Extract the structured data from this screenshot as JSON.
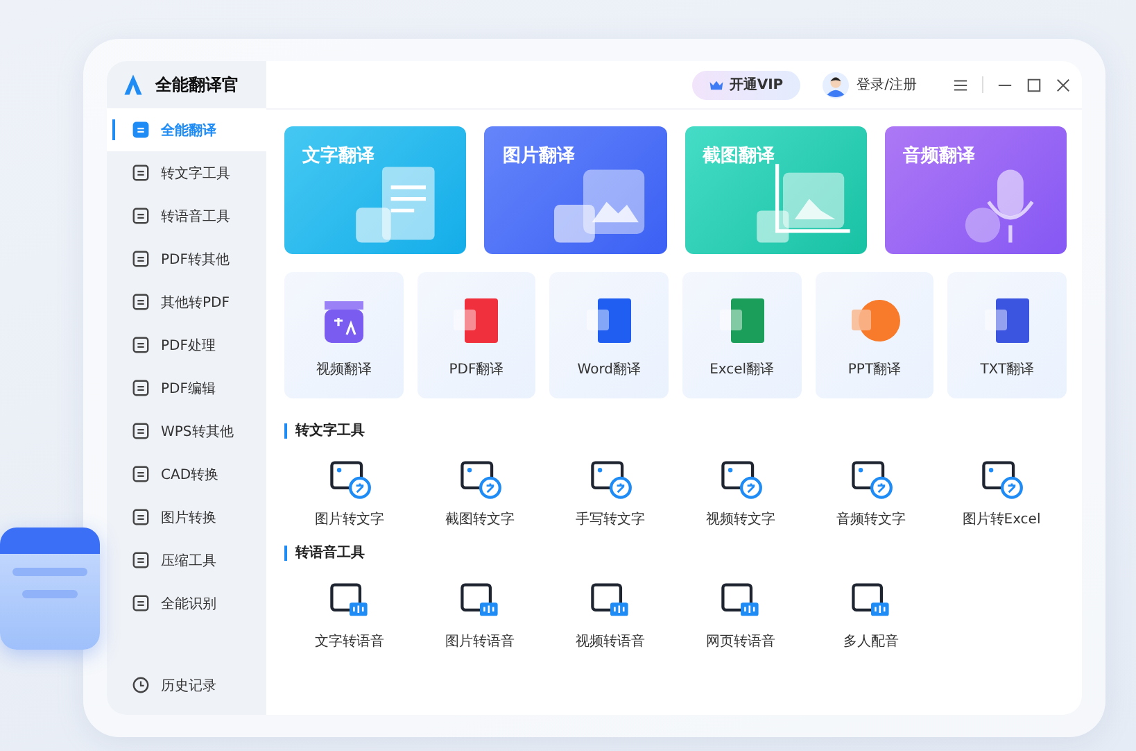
{
  "app": {
    "title": "全能翻译官"
  },
  "header": {
    "vip_button": "开通VIP",
    "login": "登录/注册"
  },
  "sidebar": {
    "items": [
      {
        "label": "全能翻译",
        "selected": true
      },
      {
        "label": "转文字工具",
        "selected": false
      },
      {
        "label": "转语音工具",
        "selected": false
      },
      {
        "label": "PDF转其他",
        "selected": false
      },
      {
        "label": "其他转PDF",
        "selected": false
      },
      {
        "label": "PDF处理",
        "selected": false
      },
      {
        "label": "PDF编辑",
        "selected": false
      },
      {
        "label": "WPS转其他",
        "selected": false
      },
      {
        "label": "CAD转换",
        "selected": false
      },
      {
        "label": "图片转换",
        "selected": false
      },
      {
        "label": "压缩工具",
        "selected": false
      },
      {
        "label": "全能识别",
        "selected": false
      }
    ],
    "footer_item": {
      "label": "历史记录"
    }
  },
  "feature_cards": [
    {
      "label": "文字翻译",
      "kind": "text"
    },
    {
      "label": "图片翻译",
      "kind": "image"
    },
    {
      "label": "截图翻译",
      "kind": "screenshot"
    },
    {
      "label": "音频翻译",
      "kind": "audio"
    }
  ],
  "file_tiles": [
    {
      "label": "视频翻译",
      "kind": "video"
    },
    {
      "label": "PDF翻译",
      "kind": "pdf"
    },
    {
      "label": "Word翻译",
      "kind": "word"
    },
    {
      "label": "Excel翻译",
      "kind": "excel"
    },
    {
      "label": "PPT翻译",
      "kind": "ppt"
    },
    {
      "label": "TXT翻译",
      "kind": "txt"
    }
  ],
  "sections": [
    {
      "title": "转文字工具",
      "kind": "text",
      "tools": [
        "图片转文字",
        "截图转文字",
        "手写转文字",
        "视频转文字",
        "音频转文字",
        "图片转Excel"
      ]
    },
    {
      "title": "转语音工具",
      "kind": "speech",
      "tools": [
        "文字转语音",
        "图片转语音",
        "视频转语音",
        "网页转语音",
        "多人配音"
      ]
    }
  ]
}
